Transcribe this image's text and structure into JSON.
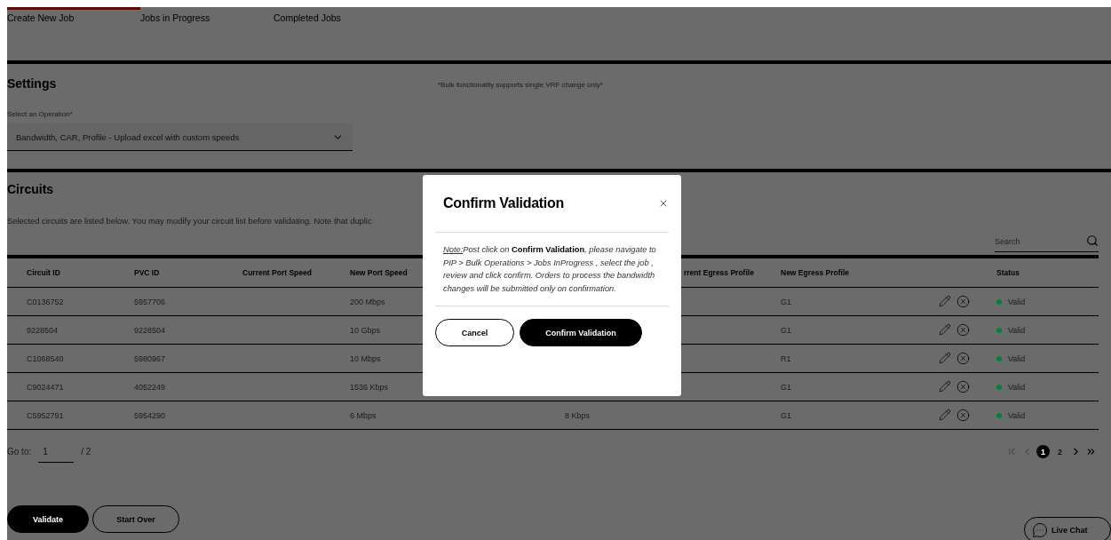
{
  "tabs": [
    {
      "label": "Create New Job",
      "selected": true
    },
    {
      "label": "Jobs in Progress",
      "selected": false
    },
    {
      "label": "Completed Jobs",
      "selected": false
    }
  ],
  "notice": "*Bulk functionality supports single VRF change only*",
  "settings": {
    "title": "Settings",
    "operation_label": "Select an Operation*",
    "operation_value": "Bandwidth, CAR, Profile - Upload excel with custom speeds"
  },
  "circuits": {
    "title": "Circuits",
    "description": "Selected circuits are listed below. You may modify your circuit list before validating. Note that duplic",
    "search": {
      "placeholder": "Search"
    }
  },
  "table": {
    "columns": [
      "Circuit ID",
      "PVC ID",
      "Current Port Speed",
      "New Port Speed",
      "",
      "",
      "rrent Egress Profile",
      "New Egress Profile",
      "",
      "Status"
    ],
    "rows": [
      {
        "cells": [
          "C0136752",
          "5957706",
          "",
          "200 Mbps",
          "",
          "",
          "",
          "G1"
        ],
        "status": "Valid",
        "color": "#008331"
      },
      {
        "cells": [
          "9228504",
          "9228504",
          "",
          "10 Gbps",
          "",
          "",
          "",
          "G1"
        ],
        "status": "Valid",
        "color": "#008331"
      },
      {
        "cells": [
          "C1068540",
          "5980967",
          "",
          "10 Mbps",
          "",
          "",
          "",
          "R1"
        ],
        "status": "Valid",
        "color": "#008331"
      },
      {
        "cells": [
          "C9024471",
          "4052249",
          "",
          "1536 Kbps",
          "",
          "",
          "",
          "G1"
        ],
        "status": "Valid",
        "color": "#008331"
      },
      {
        "cells": [
          "C5952791",
          "5954290",
          "",
          "6 Mbps",
          "",
          "8 Kbps",
          "",
          "G1"
        ],
        "status": "Valid",
        "color": "#008331"
      }
    ]
  },
  "goto": {
    "label": "Go to:",
    "value": "1",
    "total": "/ 2"
  },
  "pagination": [
    {
      "kind": "first",
      "disabled": true
    },
    {
      "kind": "prev",
      "disabled": true
    },
    {
      "kind": "page",
      "label": "1",
      "selected": true
    },
    {
      "kind": "page",
      "label": "2",
      "selected": false
    },
    {
      "kind": "next",
      "disabled": false
    },
    {
      "kind": "last",
      "disabled": false
    }
  ],
  "actions": [
    {
      "label": "Validate",
      "kind": "primary"
    },
    {
      "label": "Start Over",
      "kind": "secondary"
    }
  ],
  "live_chat": "Live Chat",
  "modal": {
    "title": "Confirm Validation",
    "note_label": "Note:",
    "note": "Post click on **Confirm Validation**, please navigate to PIP > Bulk Operations > Jobs InProgress , select the job , review and click confirm. Orders to process the bandwidth changes will be submitted only on confirmation.",
    "buttons": [
      {
        "label": "Cancel",
        "kind": "secondary"
      },
      {
        "label": "Confirm Validation",
        "kind": "primary"
      }
    ]
  }
}
